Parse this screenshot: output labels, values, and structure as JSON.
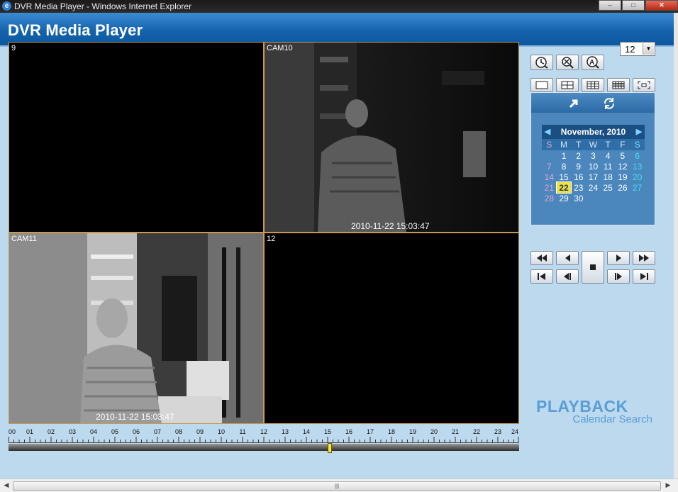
{
  "window": {
    "title": "DVR Media Player - Windows Internet Explorer",
    "min": "–",
    "max": "□",
    "close": "✕"
  },
  "app": {
    "title": "DVR Media Player"
  },
  "cameras": [
    {
      "label": "9",
      "timestamp": ""
    },
    {
      "label": "CAM10",
      "timestamp": "2010-11-22 15:03:47"
    },
    {
      "label": "CAM11",
      "timestamp": "2010-11-22 15:03:47"
    },
    {
      "label": "12",
      "timestamp": ""
    }
  ],
  "timeline": {
    "hours": [
      "00",
      "01",
      "02",
      "03",
      "04",
      "05",
      "06",
      "07",
      "08",
      "09",
      "10",
      "11",
      "12",
      "13",
      "14",
      "15",
      "16",
      "17",
      "18",
      "19",
      "20",
      "21",
      "22",
      "23",
      "24"
    ],
    "cursor_hour": 15.06
  },
  "controls": {
    "channel_select": "12",
    "dropdown_arrow": "▼",
    "icons": [
      "clock-search-icon",
      "zoom-search-icon",
      "text-search-icon"
    ],
    "layouts": [
      "single-layout-icon",
      "quad-layout-icon",
      "nine-layout-icon",
      "sixteen-layout-icon",
      "fullscreen-icon"
    ]
  },
  "calendar": {
    "month_label": "November, 2010",
    "prev": "◀",
    "next": "▶",
    "weekdays": [
      "S",
      "M",
      "T",
      "W",
      "T",
      "F",
      "S"
    ],
    "weeks": [
      [
        "",
        "1",
        "2",
        "3",
        "4",
        "5",
        "6"
      ],
      [
        "7",
        "8",
        "9",
        "10",
        "11",
        "12",
        "13"
      ],
      [
        "14",
        "15",
        "16",
        "17",
        "18",
        "19",
        "20"
      ],
      [
        "21",
        "22",
        "23",
        "24",
        "25",
        "26",
        "27"
      ],
      [
        "28",
        "29",
        "30",
        "",
        "",
        "",
        ""
      ]
    ],
    "selected_day": "22",
    "panel_icons": [
      "export-icon",
      "refresh-icon"
    ]
  },
  "playback": {
    "row1": [
      "fast-rewind-icon",
      "rewind-icon",
      "stop-icon",
      "play-icon",
      "fast-forward-icon"
    ],
    "row2": [
      "first-frame-icon",
      "step-back-icon",
      "step-forward-icon",
      "last-frame-icon"
    ]
  },
  "brand": {
    "primary": "PLAYBACK",
    "secondary": "Calendar Search"
  },
  "scrollbar": {
    "grip": "|||"
  },
  "colors": {
    "header": "#1463ad",
    "panel": "#bcd9ee",
    "calendar": "#4b86bc",
    "today": "#f3e03c",
    "brand_text": "#5a9ed6"
  }
}
